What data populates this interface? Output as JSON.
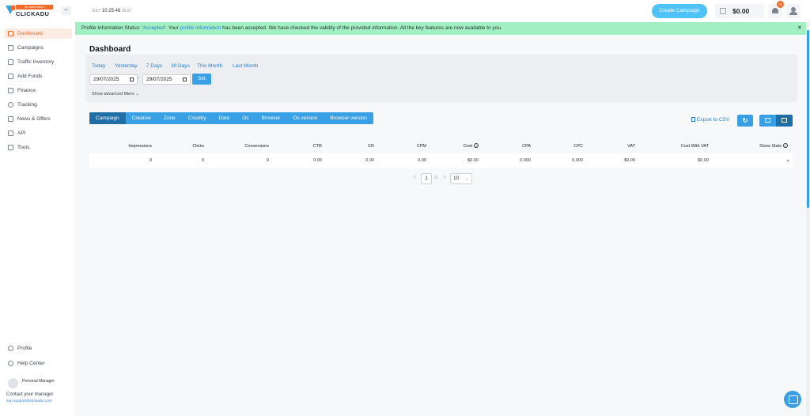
{
  "header": {
    "logo_tagline": "for advertisers",
    "logo_text": "CLICKADU",
    "collapse_icon": "collapse-left-icon",
    "clock_label": "EST:",
    "time": "10:25:46",
    "date": "29.07",
    "create_button": "Create Campaign",
    "balance": "$0.00",
    "notification_count": "15"
  },
  "sidebar": {
    "items": [
      {
        "label": "Dashboard",
        "icon": "dashboard-icon",
        "active": true
      },
      {
        "label": "Campaigns",
        "icon": "megaphone-icon"
      },
      {
        "label": "Traffic Inventory",
        "icon": "inventory-icon"
      },
      {
        "label": "Add Funds",
        "icon": "add-funds-icon"
      },
      {
        "label": "Finance",
        "icon": "finance-icon"
      },
      {
        "label": "Tracking",
        "icon": "tracking-icon"
      },
      {
        "label": "News & Offers",
        "icon": "gift-icon"
      },
      {
        "label": "API",
        "icon": "api-icon"
      },
      {
        "label": "Tools",
        "icon": "tools-icon"
      }
    ],
    "bottom_items": [
      {
        "label": "Profile",
        "icon": "profile-icon"
      },
      {
        "label": "Help Center",
        "icon": "help-icon"
      }
    ],
    "manager": {
      "role": "Personal Manager",
      "contact": "Contact your manager",
      "email": "sup.support@clickadu.com"
    }
  },
  "alert": {
    "prefix": "Profile Information Status: '",
    "status": "Accepted",
    "middle": "'. Your ",
    "link": "profile information",
    "suffix": " has been accepted. We have checked the validity of the provided information. All the key features are now available to you.",
    "close": "×"
  },
  "page_title": "Dashboard",
  "filters": {
    "ranges": [
      "Today",
      "Yesterday",
      "7 Days",
      "30 Days",
      "This Month",
      "Last Month"
    ],
    "date_from": "29/07/2025",
    "date_to": "29/07/2025",
    "separator": "-",
    "set_button": "Set",
    "advanced": "Show advanced filters"
  },
  "group_tabs": [
    "Campaign",
    "Creative",
    "Zone",
    "Country",
    "Date",
    "Os",
    "Browser",
    "Os version",
    "Browser version"
  ],
  "toolbar": {
    "export": "Export to CSV",
    "refresh_icon": "refresh-icon",
    "chart_view_icon": "chart-view-icon",
    "table_view_icon": "table-view-icon"
  },
  "table": {
    "columns": [
      "Impressions",
      "Clicks",
      "Conversions",
      "CTR",
      "CR",
      "CPM",
      "Cost",
      "CPA",
      "CPC",
      "VAT",
      "Cost With VAT",
      "Show Stats"
    ],
    "row": [
      "0",
      "0",
      "0",
      "0.00",
      "0.00",
      "0.00",
      "$0.00",
      "0.000",
      "0.000",
      "$0.00",
      "$0.00"
    ]
  },
  "pagination": {
    "prev": "<",
    "current": "1",
    "total": "/1",
    "next": ">",
    "page_size": "10"
  },
  "colors": {
    "accent": "#3aa0e6",
    "accent_dark": "#1f6ea6",
    "brand_orange": "#f26b2b",
    "alert_bg": "#a3efc4"
  }
}
